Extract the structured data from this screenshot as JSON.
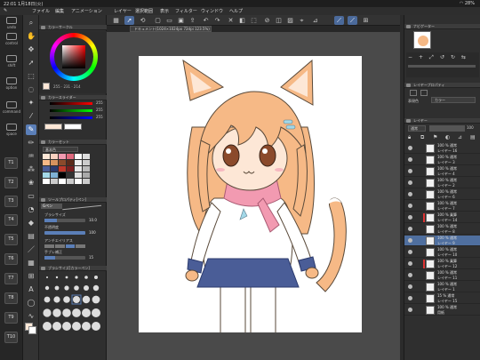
{
  "status": {
    "time_date": "22:01  1月18日(火)",
    "battery": "28%"
  },
  "menu": [
    "ファイル",
    "編集",
    "アニメーション",
    "レイヤー",
    "選択範囲",
    "表示",
    "フィルター",
    "ウィンドウ",
    "ヘルプ"
  ],
  "command_bar": {
    "labels": [
      "undo",
      "control",
      "shift",
      "option",
      "command",
      "space"
    ],
    "shortcut_keys": [
      "T1",
      "T2",
      "T3",
      "T4",
      "T5",
      "T6",
      "T7",
      "T8",
      "T9",
      "T10"
    ]
  },
  "panels": {
    "color_wheel": "カラーサークル",
    "color_slider": "カラースライダー",
    "color_set": "カラーセット",
    "color_set_name": "基本色",
    "tool_property": "ツールプロパティ[ペン]",
    "brush_size_label": "ブラシサイズ",
    "opacity_label": "不透明度",
    "antialias_label": "アンチエイリアス",
    "stabilization_label": "手ブレ補正",
    "brush_size_panel": "ブラシサイズ[カラーペン]"
  },
  "rgb": {
    "r": "255",
    "g": "255",
    "b": "255"
  },
  "props": {
    "brush_size": "10.0",
    "opacity": "100",
    "stabilization": "15"
  },
  "document": {
    "tab": "ドキュメント(1024×1024px 72dpi 123.5%)"
  },
  "right_panel": {
    "navigator": "ナビゲーター",
    "layer_property": "レイヤープロパティ",
    "expression_label": "表現色",
    "expression_value": "カラー",
    "layer_title": "レイヤー",
    "blend_mode": "通常",
    "opacity": "100"
  },
  "layers": [
    {
      "pct": "100 % 通常",
      "name": "レイヤー 16"
    },
    {
      "pct": "100 % 通常",
      "name": "レイヤー 3"
    },
    {
      "pct": "100 % 通常",
      "name": "レイヤー 4"
    },
    {
      "pct": "100 % 通常",
      "name": "レイヤー 2"
    },
    {
      "pct": "100 % 通常",
      "name": "レイヤー 6"
    },
    {
      "pct": "100 % 通常",
      "name": "レイヤー 7"
    },
    {
      "pct": "100 % 乗算",
      "name": "レイヤー 14"
    },
    {
      "pct": "100 % 通常",
      "name": "レイヤー 8"
    },
    {
      "pct": "100 % 通常",
      "name": "レイヤー 9"
    },
    {
      "pct": "100 % 通常",
      "name": "レイヤー 10"
    },
    {
      "pct": "100 % 乗算",
      "name": "レイヤー 12"
    },
    {
      "pct": "100 % 通常",
      "name": "レイヤー 11"
    },
    {
      "pct": "100 % 通常",
      "name": "レイヤー 1"
    },
    {
      "pct": "15 % 通常",
      "name": "レイヤー 15"
    },
    {
      "pct": "100 % 通常",
      "name": "用紙"
    }
  ],
  "colors": {
    "accent": "#5b7fb8",
    "skin": "#fde7d6",
    "hair": "#f6b986",
    "scarf": "#f29ab1",
    "skirt": "#4a5d97"
  }
}
